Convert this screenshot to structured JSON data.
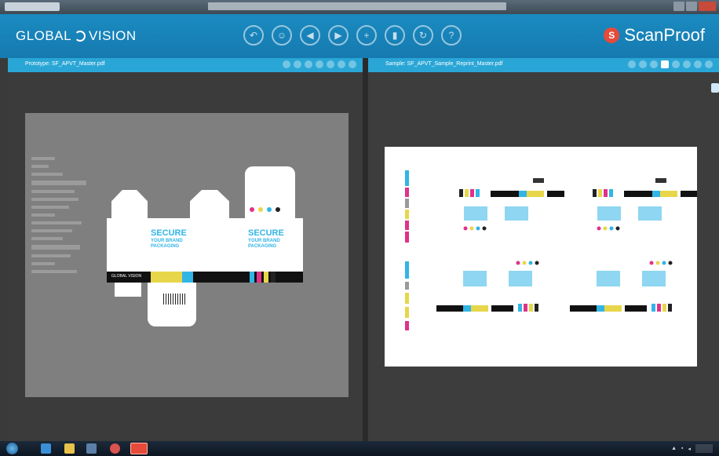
{
  "app": {
    "brand_left": "GLOBAL",
    "brand_left_suffix": "VISION",
    "brand_right": "ScanProof"
  },
  "toolbar": {
    "icons": [
      "undo-icon",
      "user-icon",
      "back-icon",
      "play-icon",
      "add-icon",
      "trash-icon",
      "refresh-icon",
      "help-icon"
    ]
  },
  "left_panel": {
    "title": "Prototype: SF_APVT_Master.pdf"
  },
  "right_panel": {
    "title": "Sample: SF_APVT_Sample_Reprint_Master.pdf"
  },
  "packaging": {
    "headline_1": "SECURE",
    "headline_2": "YOUR BRAND",
    "headline_3": "PACKAGING",
    "brand_stripe": "GLOBAL VISION"
  },
  "colors": {
    "header": "#1a8bc0",
    "panel_bar": "#2aa6d6",
    "accent_cyan": "#31b5e6",
    "accent_magenta": "#e0318a",
    "accent_yellow": "#e8d64a",
    "logo_red": "#e64a3a"
  }
}
